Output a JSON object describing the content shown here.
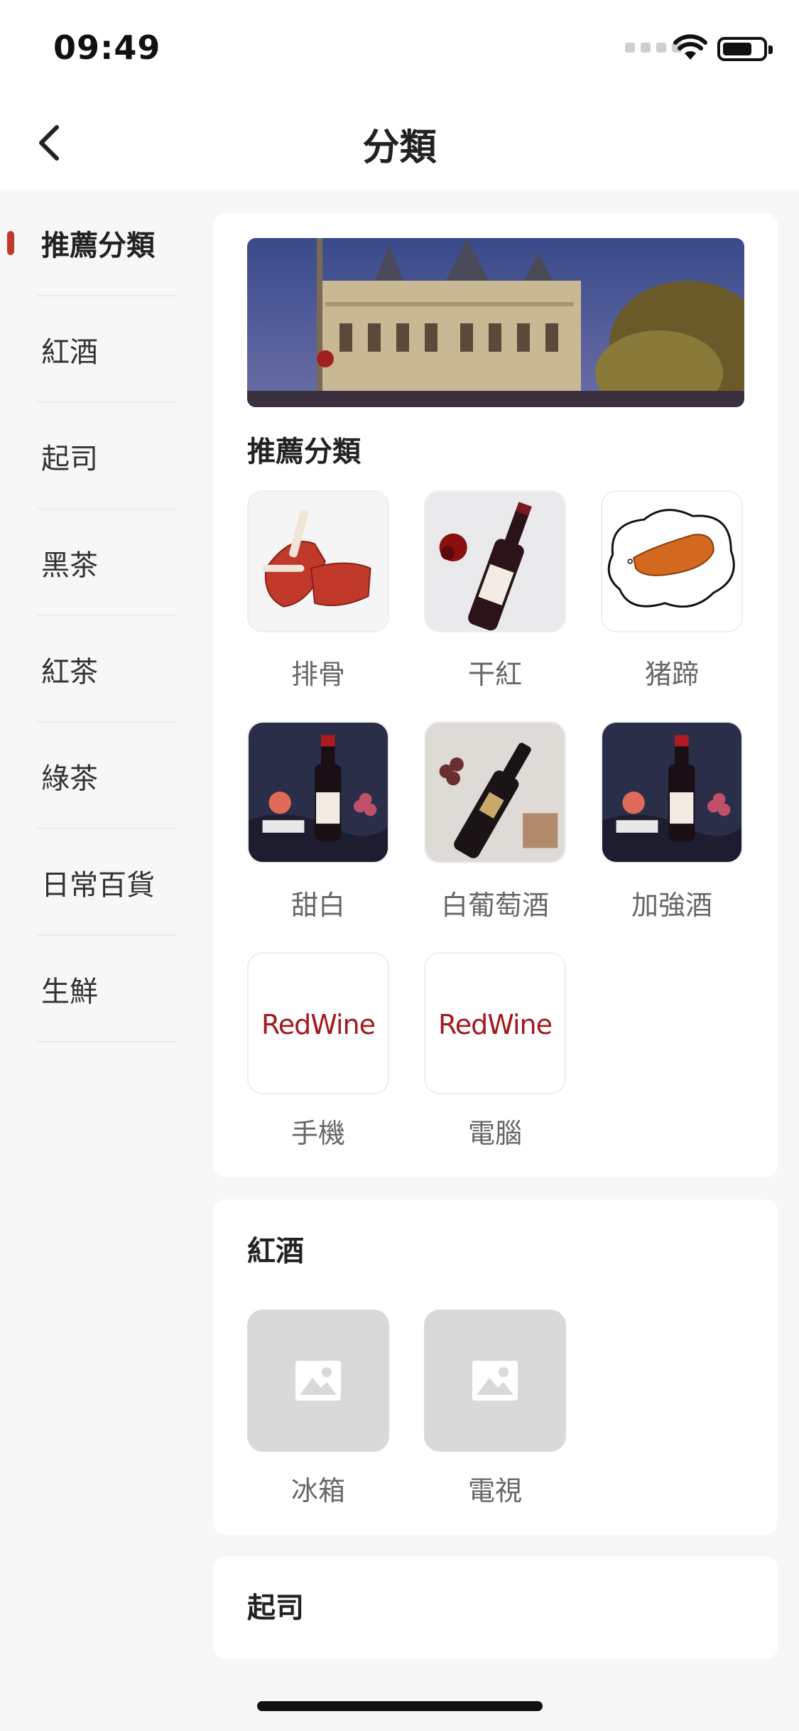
{
  "status": {
    "time": "09:49"
  },
  "nav": {
    "title": "分類"
  },
  "sidebar": {
    "items": [
      {
        "label": "推薦分類"
      },
      {
        "label": "紅酒"
      },
      {
        "label": "起司"
      },
      {
        "label": "黑茶"
      },
      {
        "label": "紅茶"
      },
      {
        "label": "綠茶"
      },
      {
        "label": "日常百貨"
      },
      {
        "label": "生鮮"
      }
    ]
  },
  "recommended": {
    "title": "推薦分類",
    "items": [
      {
        "label": "排骨"
      },
      {
        "label": "干紅"
      },
      {
        "label": "猪蹄"
      },
      {
        "label": "甜白"
      },
      {
        "label": "白葡萄酒"
      },
      {
        "label": "加強酒"
      },
      {
        "label": "手機",
        "logo": "RedWine"
      },
      {
        "label": "電腦",
        "logo": "RedWine"
      }
    ]
  },
  "redwine_section": {
    "title": "紅酒",
    "items": [
      {
        "label": "冰箱"
      },
      {
        "label": "電視"
      }
    ]
  },
  "cheese_section": {
    "title": "起司"
  },
  "colors": {
    "accent": "#c0392b",
    "logo": "#a3191e"
  }
}
